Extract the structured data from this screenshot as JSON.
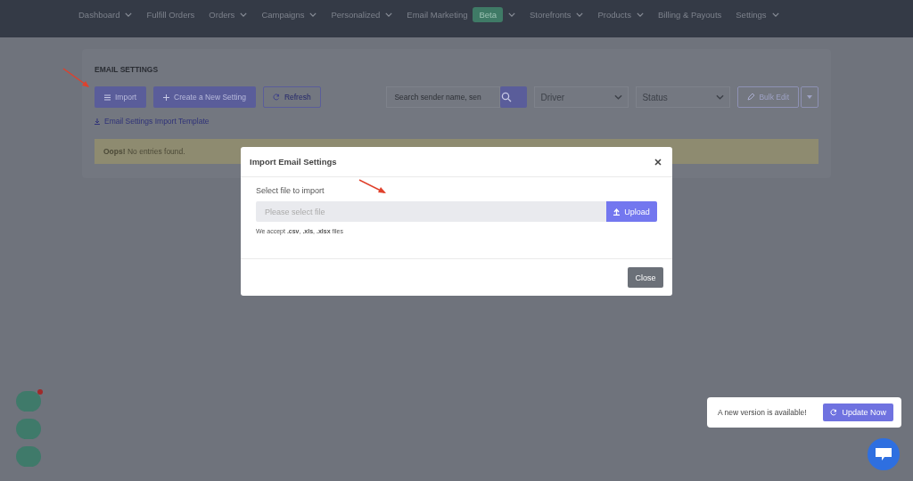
{
  "nav": [
    {
      "label": "Dashboard",
      "dropdown": true
    },
    {
      "label": "Fulfill Orders",
      "dropdown": false
    },
    {
      "label": "Orders",
      "dropdown": true
    },
    {
      "label": "Campaigns",
      "dropdown": true
    },
    {
      "label": "Personalized",
      "dropdown": true
    },
    {
      "label": "Email Marketing",
      "badge": "Beta",
      "dropdown": true
    },
    {
      "label": "Storefronts",
      "dropdown": true
    },
    {
      "label": "Products",
      "dropdown": true
    },
    {
      "label": "Billing & Payouts",
      "dropdown": false
    },
    {
      "label": "Settings",
      "dropdown": true
    }
  ],
  "page": {
    "title": "EMAIL SETTINGS",
    "import_button": "Import",
    "create_button": "Create a New Setting",
    "refresh_button": "Refresh",
    "search": {
      "placeholder": "Search sender name, sen"
    },
    "driver_select": "Driver",
    "status_select": "Status",
    "bulk_edit_button": "Bulk Edit",
    "template_link": "Email Settings Import Template",
    "alert": "**Oops!** No entries found."
  },
  "modal": {
    "title": "Import Email Settings",
    "field_label": "Select file to import",
    "file_field": {
      "placeholder": "Please select file"
    },
    "upload_button": "Upload",
    "hint": "We accept **.csv**, **.xls**, **.xlsx** files",
    "close_button": "Close"
  },
  "floating_buttons": [
    {
      "notification": true
    },
    {
      "notification": false
    },
    {
      "notification": false
    }
  ],
  "toast": {
    "message": "A new version is available!",
    "button": "Update Now"
  }
}
